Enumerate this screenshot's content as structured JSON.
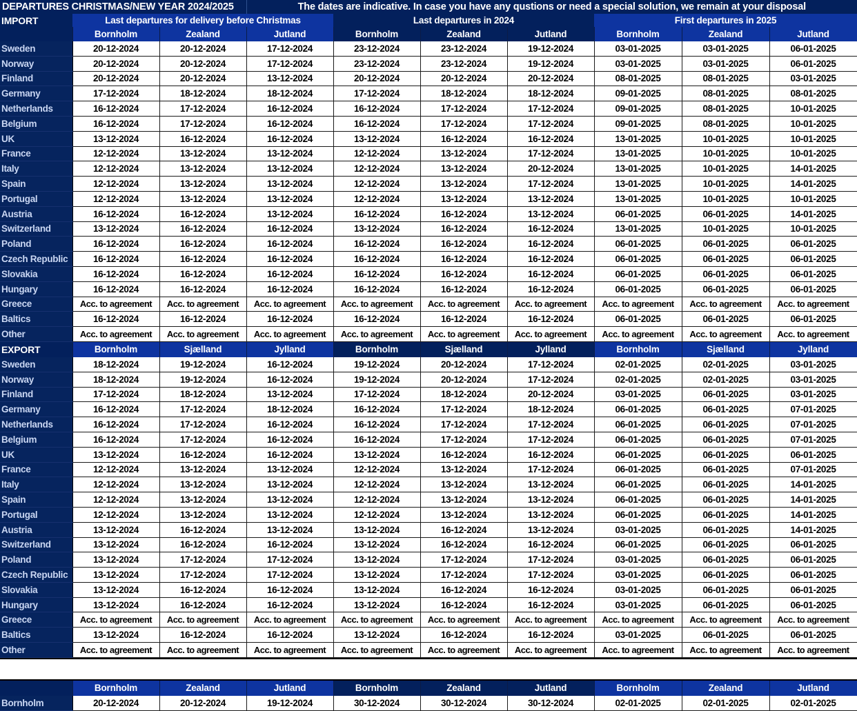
{
  "header": {
    "title": "DEPARTURES CHRISTMAS/NEW YEAR 2024/2025",
    "note": "The dates are indicative. In case you have any qustions or need a special solution, we remain at your disposal"
  },
  "colors": {
    "dark_navy": "#03205C",
    "accent_blue": "#0E34A0",
    "label_navy": "#06245E",
    "label_text": "#C9D6F2",
    "cell_bg": "#FFFFFF",
    "cell_text": "#000000",
    "page_bg": "#000000"
  },
  "groups": [
    {
      "label": "Last departures for delivery before Christmas"
    },
    {
      "label": "Last departures in 2024"
    },
    {
      "label": "First departures in 2025"
    }
  ],
  "import": {
    "section_label": "IMPORT",
    "columns": [
      "Bornholm",
      "Zealand",
      "Jutland",
      "Bornholm",
      "Zealand",
      "Jutland",
      "Bornholm",
      "Zealand",
      "Jutland"
    ],
    "rows": [
      {
        "label": "Sweden",
        "values": [
          "20-12-2024",
          "20-12-2024",
          "17-12-2024",
          "23-12-2024",
          "23-12-2024",
          "19-12-2024",
          "03-01-2025",
          "03-01-2025",
          "06-01-2025"
        ]
      },
      {
        "label": "Norway",
        "values": [
          "20-12-2024",
          "20-12-2024",
          "17-12-2024",
          "23-12-2024",
          "23-12-2024",
          "19-12-2024",
          "03-01-2025",
          "03-01-2025",
          "06-01-2025"
        ]
      },
      {
        "label": "Finland",
        "values": [
          "20-12-2024",
          "20-12-2024",
          "13-12-2024",
          "20-12-2024",
          "20-12-2024",
          "20-12-2024",
          "08-01-2025",
          "08-01-2025",
          "03-01-2025"
        ]
      },
      {
        "label": "Germany",
        "values": [
          "17-12-2024",
          "18-12-2024",
          "18-12-2024",
          "17-12-2024",
          "18-12-2024",
          "18-12-2024",
          "09-01-2025",
          "08-01-2025",
          "08-01-2025"
        ]
      },
      {
        "label": "Netherlands",
        "values": [
          "16-12-2024",
          "17-12-2024",
          "16-12-2024",
          "16-12-2024",
          "17-12-2024",
          "17-12-2024",
          "09-01-2025",
          "08-01-2025",
          "10-01-2025"
        ]
      },
      {
        "label": "Belgium",
        "values": [
          "16-12-2024",
          "17-12-2024",
          "16-12-2024",
          "16-12-2024",
          "17-12-2024",
          "17-12-2024",
          "09-01-2025",
          "08-01-2025",
          "10-01-2025"
        ]
      },
      {
        "label": "UK",
        "values": [
          "13-12-2024",
          "16-12-2024",
          "16-12-2024",
          "13-12-2024",
          "16-12-2024",
          "16-12-2024",
          "13-01-2025",
          "10-01-2025",
          "10-01-2025"
        ]
      },
      {
        "label": "France",
        "values": [
          "12-12-2024",
          "13-12-2024",
          "13-12-2024",
          "12-12-2024",
          "13-12-2024",
          "17-12-2024",
          "13-01-2025",
          "10-01-2025",
          "10-01-2025"
        ]
      },
      {
        "label": "Italy",
        "values": [
          "12-12-2024",
          "13-12-2024",
          "13-12-2024",
          "12-12-2024",
          "13-12-2024",
          "20-12-2024",
          "13-01-2025",
          "10-01-2025",
          "14-01-2025"
        ]
      },
      {
        "label": "Spain",
        "values": [
          "12-12-2024",
          "13-12-2024",
          "13-12-2024",
          "12-12-2024",
          "13-12-2024",
          "17-12-2024",
          "13-01-2025",
          "10-01-2025",
          "14-01-2025"
        ]
      },
      {
        "label": "Portugal",
        "values": [
          "12-12-2024",
          "13-12-2024",
          "13-12-2024",
          "12-12-2024",
          "13-12-2024",
          "13-12-2024",
          "13-01-2025",
          "10-01-2025",
          "10-01-2025"
        ]
      },
      {
        "label": "Austria",
        "values": [
          "16-12-2024",
          "16-12-2024",
          "13-12-2024",
          "16-12-2024",
          "16-12-2024",
          "13-12-2024",
          "06-01-2025",
          "06-01-2025",
          "14-01-2025"
        ]
      },
      {
        "label": "Switzerland",
        "values": [
          "13-12-2024",
          "16-12-2024",
          "16-12-2024",
          "13-12-2024",
          "16-12-2024",
          "16-12-2024",
          "13-01-2025",
          "10-01-2025",
          "10-01-2025"
        ]
      },
      {
        "label": "Poland",
        "values": [
          "16-12-2024",
          "16-12-2024",
          "16-12-2024",
          "16-12-2024",
          "16-12-2024",
          "16-12-2024",
          "06-01-2025",
          "06-01-2025",
          "06-01-2025"
        ]
      },
      {
        "label": "Czech Republic",
        "values": [
          "16-12-2024",
          "16-12-2024",
          "16-12-2024",
          "16-12-2024",
          "16-12-2024",
          "16-12-2024",
          "06-01-2025",
          "06-01-2025",
          "06-01-2025"
        ]
      },
      {
        "label": "Slovakia",
        "values": [
          "16-12-2024",
          "16-12-2024",
          "16-12-2024",
          "16-12-2024",
          "16-12-2024",
          "16-12-2024",
          "06-01-2025",
          "06-01-2025",
          "06-01-2025"
        ]
      },
      {
        "label": "Hungary",
        "values": [
          "16-12-2024",
          "16-12-2024",
          "16-12-2024",
          "16-12-2024",
          "16-12-2024",
          "16-12-2024",
          "06-01-2025",
          "06-01-2025",
          "06-01-2025"
        ]
      },
      {
        "label": "Greece",
        "values": [
          "Acc. to agreement",
          "Acc. to agreement",
          "Acc. to agreement",
          "Acc. to agreement",
          "Acc. to agreement",
          "Acc. to agreement",
          "Acc. to agreement",
          "Acc. to agreement",
          "Acc. to agreement"
        ]
      },
      {
        "label": "Baltics",
        "values": [
          "16-12-2024",
          "16-12-2024",
          "16-12-2024",
          "16-12-2024",
          "16-12-2024",
          "16-12-2024",
          "06-01-2025",
          "06-01-2025",
          "06-01-2025"
        ]
      },
      {
        "label": "Other",
        "values": [
          "Acc. to agreement",
          "Acc. to agreement",
          "Acc. to agreement",
          "Acc. to agreement",
          "Acc. to agreement",
          "Acc. to agreement",
          "Acc. to agreement",
          "Acc. to agreement",
          "Acc. to agreement"
        ]
      }
    ]
  },
  "export": {
    "section_label": "EXPORT",
    "columns": [
      "Bornholm",
      "Sjælland",
      "Jylland",
      "Bornholm",
      "Sjælland",
      "Jylland",
      "Bornholm",
      "Sjælland",
      "Jylland"
    ],
    "rows": [
      {
        "label": "Sweden",
        "values": [
          "18-12-2024",
          "19-12-2024",
          "16-12-2024",
          "19-12-2024",
          "20-12-2024",
          "17-12-2024",
          "02-01-2025",
          "02-01-2025",
          "03-01-2025"
        ]
      },
      {
        "label": "Norway",
        "values": [
          "18-12-2024",
          "19-12-2024",
          "16-12-2024",
          "19-12-2024",
          "20-12-2024",
          "17-12-2024",
          "02-01-2025",
          "02-01-2025",
          "03-01-2025"
        ]
      },
      {
        "label": "Finland",
        "values": [
          "17-12-2024",
          "18-12-2024",
          "13-12-2024",
          "17-12-2024",
          "18-12-2024",
          "20-12-2024",
          "03-01-2025",
          "06-01-2025",
          "03-01-2025"
        ]
      },
      {
        "label": "Germany",
        "values": [
          "16-12-2024",
          "17-12-2024",
          "18-12-2024",
          "16-12-2024",
          "17-12-2024",
          "18-12-2024",
          "06-01-2025",
          "06-01-2025",
          "07-01-2025"
        ]
      },
      {
        "label": "Netherlands",
        "values": [
          "16-12-2024",
          "17-12-2024",
          "16-12-2024",
          "16-12-2024",
          "17-12-2024",
          "17-12-2024",
          "06-01-2025",
          "06-01-2025",
          "07-01-2025"
        ]
      },
      {
        "label": "Belgium",
        "values": [
          "16-12-2024",
          "17-12-2024",
          "16-12-2024",
          "16-12-2024",
          "17-12-2024",
          "17-12-2024",
          "06-01-2025",
          "06-01-2025",
          "07-01-2025"
        ]
      },
      {
        "label": "UK",
        "values": [
          "13-12-2024",
          "16-12-2024",
          "16-12-2024",
          "13-12-2024",
          "16-12-2024",
          "16-12-2024",
          "06-01-2025",
          "06-01-2025",
          "06-01-2025"
        ]
      },
      {
        "label": "France",
        "values": [
          "12-12-2024",
          "13-12-2024",
          "13-12-2024",
          "12-12-2024",
          "13-12-2024",
          "17-12-2024",
          "06-01-2025",
          "06-01-2025",
          "07-01-2025"
        ]
      },
      {
        "label": "Italy",
        "values": [
          "12-12-2024",
          "13-12-2024",
          "13-12-2024",
          "12-12-2024",
          "13-12-2024",
          "13-12-2024",
          "06-01-2025",
          "06-01-2025",
          "14-01-2025"
        ]
      },
      {
        "label": "Spain",
        "values": [
          "12-12-2024",
          "13-12-2024",
          "13-12-2024",
          "12-12-2024",
          "13-12-2024",
          "13-12-2024",
          "06-01-2025",
          "06-01-2025",
          "14-01-2025"
        ]
      },
      {
        "label": "Portugal",
        "values": [
          "12-12-2024",
          "13-12-2024",
          "13-12-2024",
          "12-12-2024",
          "13-12-2024",
          "13-12-2024",
          "06-01-2025",
          "06-01-2025",
          "14-01-2025"
        ]
      },
      {
        "label": "Austria",
        "values": [
          "13-12-2024",
          "16-12-2024",
          "13-12-2024",
          "13-12-2024",
          "16-12-2024",
          "13-12-2024",
          "03-01-2025",
          "06-01-2025",
          "14-01-2025"
        ]
      },
      {
        "label": "Switzerland",
        "values": [
          "13-12-2024",
          "16-12-2024",
          "16-12-2024",
          "13-12-2024",
          "16-12-2024",
          "16-12-2024",
          "06-01-2025",
          "06-01-2025",
          "06-01-2025"
        ]
      },
      {
        "label": "Poland",
        "values": [
          "13-12-2024",
          "17-12-2024",
          "17-12-2024",
          "13-12-2024",
          "17-12-2024",
          "17-12-2024",
          "03-01-2025",
          "06-01-2025",
          "06-01-2025"
        ]
      },
      {
        "label": "Czech Republic",
        "values": [
          "13-12-2024",
          "17-12-2024",
          "17-12-2024",
          "13-12-2024",
          "17-12-2024",
          "17-12-2024",
          "03-01-2025",
          "06-01-2025",
          "06-01-2025"
        ]
      },
      {
        "label": "Slovakia",
        "values": [
          "13-12-2024",
          "16-12-2024",
          "16-12-2024",
          "13-12-2024",
          "16-12-2024",
          "16-12-2024",
          "03-01-2025",
          "06-01-2025",
          "06-01-2025"
        ]
      },
      {
        "label": "Hungary",
        "values": [
          "13-12-2024",
          "16-12-2024",
          "16-12-2024",
          "13-12-2024",
          "16-12-2024",
          "16-12-2024",
          "03-01-2025",
          "06-01-2025",
          "06-01-2025"
        ]
      },
      {
        "label": "Greece",
        "values": [
          "Acc. to agreement",
          "Acc. to agreement",
          "Acc. to agreement",
          "Acc. to agreement",
          "Acc. to agreement",
          "Acc. to agreement",
          "Acc. to agreement",
          "Acc. to agreement",
          "Acc. to agreement"
        ]
      },
      {
        "label": "Baltics",
        "values": [
          "13-12-2024",
          "16-12-2024",
          "16-12-2024",
          "13-12-2024",
          "16-12-2024",
          "16-12-2024",
          "03-01-2025",
          "06-01-2025",
          "06-01-2025"
        ]
      },
      {
        "label": "Other",
        "values": [
          "Acc. to agreement",
          "Acc. to agreement",
          "Acc. to agreement",
          "Acc. to agreement",
          "Acc. to agreement",
          "Acc. to agreement",
          "Acc. to agreement",
          "Acc. to agreement",
          "Acc. to agreement"
        ]
      }
    ]
  },
  "bottom": {
    "section_label": "",
    "columns": [
      "Bornholm",
      "Zealand",
      "Jutland",
      "Bornholm",
      "Zealand",
      "Jutland",
      "Bornholm",
      "Zealand",
      "Jutland"
    ],
    "rows": [
      {
        "label": "Bornholm",
        "values": [
          "20-12-2024",
          "20-12-2024",
          "19-12-2024",
          "30-12-2024",
          "30-12-2024",
          "30-12-2024",
          "02-01-2025",
          "02-01-2025",
          "02-01-2025"
        ]
      }
    ]
  }
}
